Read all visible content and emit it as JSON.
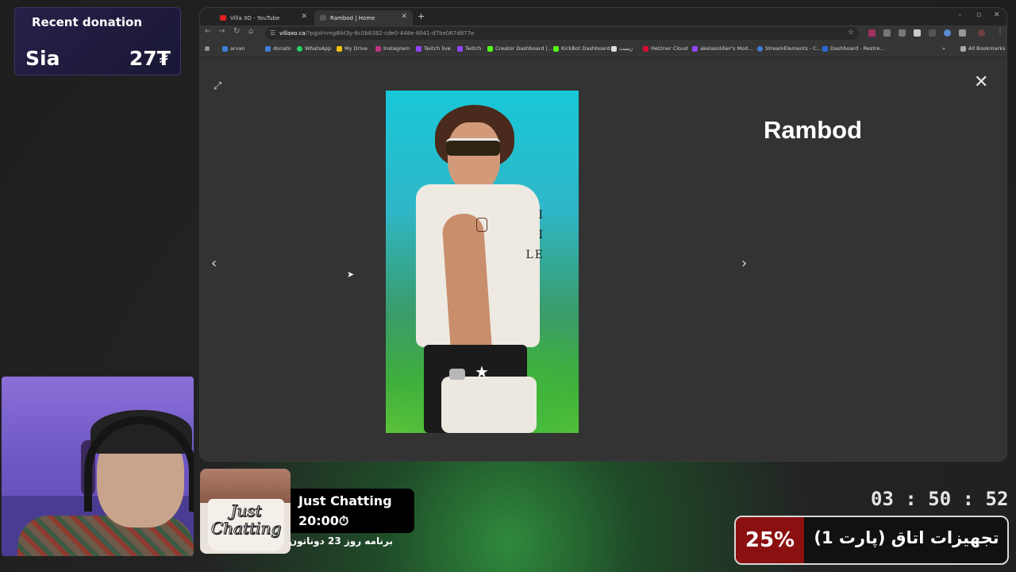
{
  "donation": {
    "title": "Recent donation",
    "name": "Sia",
    "amount": "27₮"
  },
  "browser": {
    "tabs": [
      {
        "label": "Villa XO - YouTube",
        "icon": "youtube-icon",
        "active": false
      },
      {
        "label": "Rambod | Home",
        "icon": "xo-site-icon",
        "active": true
      }
    ],
    "address": {
      "host": "villaxo.ca",
      "path": "/?pgid=mg8ikl3y-8c0b8382-cde0-448e-8041-d7be067d877e"
    },
    "bookmarks": [
      "arvan",
      "donato",
      "WhatsApp",
      "My Drive",
      "Instagram",
      "Twitch live",
      "Twitch",
      "Creator Dashboard |...",
      "KickBot Dashboard",
      "زیمیت",
      "Hetzner Cloud",
      "akelasoldier's Mod...",
      "StreamElements - C...",
      "Dashboard - Restre..."
    ],
    "all_bookmarks": "All Bookmarks",
    "page": {
      "title": "Rambod",
      "shirt_text": "I\nI\nLE"
    }
  },
  "category": {
    "image_text": "Just Chatting",
    "name": "Just Chatting",
    "time": "20:00⏱",
    "subtitle": "برنامه روز 23 دوناتون"
  },
  "timer": "03 : 50 : 52",
  "goal": {
    "percent": "25%",
    "text": "تجهیزات اتاق (پارت 1)",
    "progress": 0.25
  },
  "colors": {
    "accent_red": "#8b1010",
    "donation_bg": "#252048",
    "webcam_bg": "#8b6fd8"
  }
}
